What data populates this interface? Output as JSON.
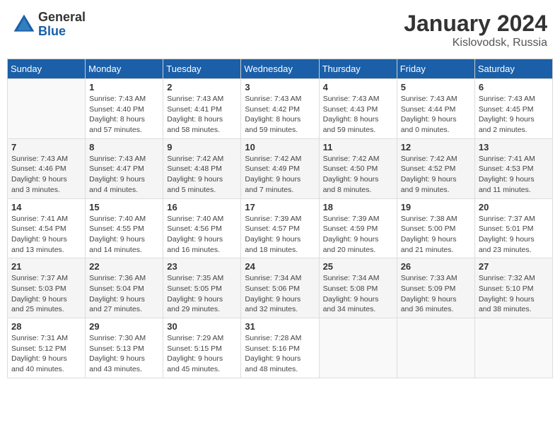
{
  "header": {
    "logo_general": "General",
    "logo_blue": "Blue",
    "month_title": "January 2024",
    "location": "Kislovodsk, Russia"
  },
  "weekdays": [
    "Sunday",
    "Monday",
    "Tuesday",
    "Wednesday",
    "Thursday",
    "Friday",
    "Saturday"
  ],
  "weeks": [
    [
      {
        "day": "",
        "empty": true
      },
      {
        "day": "1",
        "sunrise": "Sunrise: 7:43 AM",
        "sunset": "Sunset: 4:40 PM",
        "daylight": "Daylight: 8 hours and 57 minutes."
      },
      {
        "day": "2",
        "sunrise": "Sunrise: 7:43 AM",
        "sunset": "Sunset: 4:41 PM",
        "daylight": "Daylight: 8 hours and 58 minutes."
      },
      {
        "day": "3",
        "sunrise": "Sunrise: 7:43 AM",
        "sunset": "Sunset: 4:42 PM",
        "daylight": "Daylight: 8 hours and 59 minutes."
      },
      {
        "day": "4",
        "sunrise": "Sunrise: 7:43 AM",
        "sunset": "Sunset: 4:43 PM",
        "daylight": "Daylight: 8 hours and 59 minutes."
      },
      {
        "day": "5",
        "sunrise": "Sunrise: 7:43 AM",
        "sunset": "Sunset: 4:44 PM",
        "daylight": "Daylight: 9 hours and 0 minutes."
      },
      {
        "day": "6",
        "sunrise": "Sunrise: 7:43 AM",
        "sunset": "Sunset: 4:45 PM",
        "daylight": "Daylight: 9 hours and 2 minutes."
      }
    ],
    [
      {
        "day": "7",
        "sunrise": "Sunrise: 7:43 AM",
        "sunset": "Sunset: 4:46 PM",
        "daylight": "Daylight: 9 hours and 3 minutes."
      },
      {
        "day": "8",
        "sunrise": "Sunrise: 7:43 AM",
        "sunset": "Sunset: 4:47 PM",
        "daylight": "Daylight: 9 hours and 4 minutes."
      },
      {
        "day": "9",
        "sunrise": "Sunrise: 7:42 AM",
        "sunset": "Sunset: 4:48 PM",
        "daylight": "Daylight: 9 hours and 5 minutes."
      },
      {
        "day": "10",
        "sunrise": "Sunrise: 7:42 AM",
        "sunset": "Sunset: 4:49 PM",
        "daylight": "Daylight: 9 hours and 7 minutes."
      },
      {
        "day": "11",
        "sunrise": "Sunrise: 7:42 AM",
        "sunset": "Sunset: 4:50 PM",
        "daylight": "Daylight: 9 hours and 8 minutes."
      },
      {
        "day": "12",
        "sunrise": "Sunrise: 7:42 AM",
        "sunset": "Sunset: 4:52 PM",
        "daylight": "Daylight: 9 hours and 9 minutes."
      },
      {
        "day": "13",
        "sunrise": "Sunrise: 7:41 AM",
        "sunset": "Sunset: 4:53 PM",
        "daylight": "Daylight: 9 hours and 11 minutes."
      }
    ],
    [
      {
        "day": "14",
        "sunrise": "Sunrise: 7:41 AM",
        "sunset": "Sunset: 4:54 PM",
        "daylight": "Daylight: 9 hours and 13 minutes."
      },
      {
        "day": "15",
        "sunrise": "Sunrise: 7:40 AM",
        "sunset": "Sunset: 4:55 PM",
        "daylight": "Daylight: 9 hours and 14 minutes."
      },
      {
        "day": "16",
        "sunrise": "Sunrise: 7:40 AM",
        "sunset": "Sunset: 4:56 PM",
        "daylight": "Daylight: 9 hours and 16 minutes."
      },
      {
        "day": "17",
        "sunrise": "Sunrise: 7:39 AM",
        "sunset": "Sunset: 4:57 PM",
        "daylight": "Daylight: 9 hours and 18 minutes."
      },
      {
        "day": "18",
        "sunrise": "Sunrise: 7:39 AM",
        "sunset": "Sunset: 4:59 PM",
        "daylight": "Daylight: 9 hours and 20 minutes."
      },
      {
        "day": "19",
        "sunrise": "Sunrise: 7:38 AM",
        "sunset": "Sunset: 5:00 PM",
        "daylight": "Daylight: 9 hours and 21 minutes."
      },
      {
        "day": "20",
        "sunrise": "Sunrise: 7:37 AM",
        "sunset": "Sunset: 5:01 PM",
        "daylight": "Daylight: 9 hours and 23 minutes."
      }
    ],
    [
      {
        "day": "21",
        "sunrise": "Sunrise: 7:37 AM",
        "sunset": "Sunset: 5:03 PM",
        "daylight": "Daylight: 9 hours and 25 minutes."
      },
      {
        "day": "22",
        "sunrise": "Sunrise: 7:36 AM",
        "sunset": "Sunset: 5:04 PM",
        "daylight": "Daylight: 9 hours and 27 minutes."
      },
      {
        "day": "23",
        "sunrise": "Sunrise: 7:35 AM",
        "sunset": "Sunset: 5:05 PM",
        "daylight": "Daylight: 9 hours and 29 minutes."
      },
      {
        "day": "24",
        "sunrise": "Sunrise: 7:34 AM",
        "sunset": "Sunset: 5:06 PM",
        "daylight": "Daylight: 9 hours and 32 minutes."
      },
      {
        "day": "25",
        "sunrise": "Sunrise: 7:34 AM",
        "sunset": "Sunset: 5:08 PM",
        "daylight": "Daylight: 9 hours and 34 minutes."
      },
      {
        "day": "26",
        "sunrise": "Sunrise: 7:33 AM",
        "sunset": "Sunset: 5:09 PM",
        "daylight": "Daylight: 9 hours and 36 minutes."
      },
      {
        "day": "27",
        "sunrise": "Sunrise: 7:32 AM",
        "sunset": "Sunset: 5:10 PM",
        "daylight": "Daylight: 9 hours and 38 minutes."
      }
    ],
    [
      {
        "day": "28",
        "sunrise": "Sunrise: 7:31 AM",
        "sunset": "Sunset: 5:12 PM",
        "daylight": "Daylight: 9 hours and 40 minutes."
      },
      {
        "day": "29",
        "sunrise": "Sunrise: 7:30 AM",
        "sunset": "Sunset: 5:13 PM",
        "daylight": "Daylight: 9 hours and 43 minutes."
      },
      {
        "day": "30",
        "sunrise": "Sunrise: 7:29 AM",
        "sunset": "Sunset: 5:15 PM",
        "daylight": "Daylight: 9 hours and 45 minutes."
      },
      {
        "day": "31",
        "sunrise": "Sunrise: 7:28 AM",
        "sunset": "Sunset: 5:16 PM",
        "daylight": "Daylight: 9 hours and 48 minutes."
      },
      {
        "day": "",
        "empty": true
      },
      {
        "day": "",
        "empty": true
      },
      {
        "day": "",
        "empty": true
      }
    ]
  ]
}
